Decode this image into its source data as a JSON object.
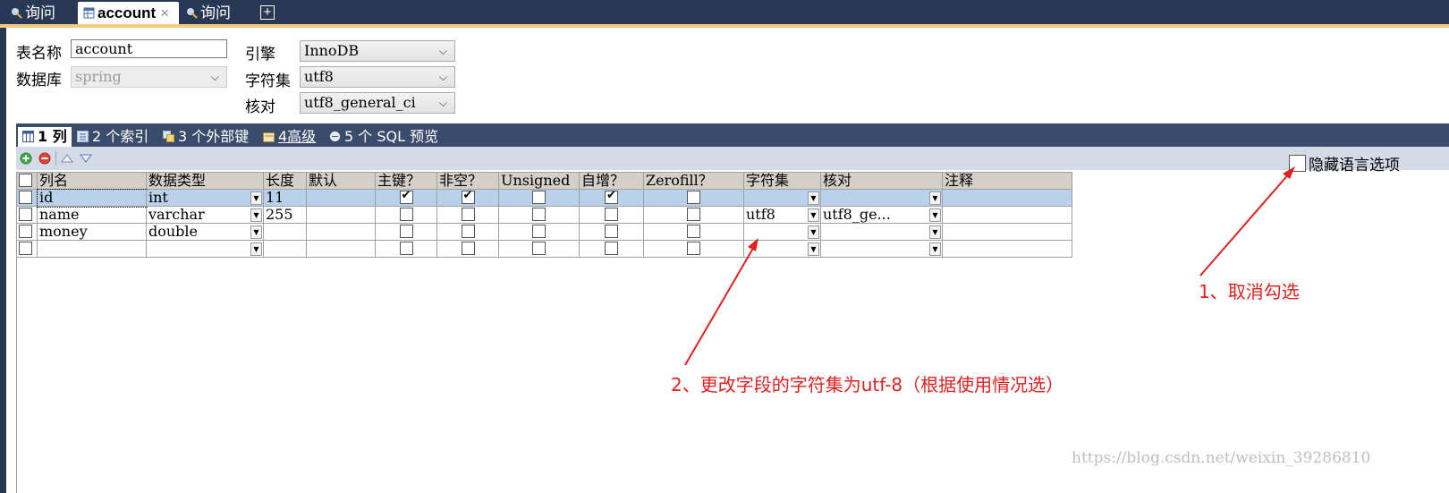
{
  "tabs": [
    {
      "label": "询问",
      "icon": "query-icon",
      "active": false
    },
    {
      "label": "account",
      "icon": "table-icon",
      "active": true,
      "close": "×"
    },
    {
      "label": "询问",
      "icon": "query-icon",
      "active": false
    }
  ],
  "add_tab": "+",
  "form": {
    "table_name_label": "表名称",
    "table_name_value": "account",
    "database_label": "数据库",
    "database_value": "spring",
    "engine_label": "引擎",
    "engine_value": "InnoDB",
    "charset_label": "字符集",
    "charset_value": "utf8",
    "collation_label": "核对",
    "collation_value": "utf8_general_ci"
  },
  "sub_tabs": [
    {
      "label": "1 列",
      "icon": "columns-icon",
      "active": true
    },
    {
      "label": "2 个索引",
      "icon": "index-icon"
    },
    {
      "label": "3 个外部键",
      "icon": "foreign-key-icon"
    },
    {
      "label": "4高级",
      "icon": "advanced-icon"
    },
    {
      "label": "5 个 SQL 预览",
      "icon": "sql-preview-icon"
    }
  ],
  "toolbar": {
    "hide_language_options": "隐藏语言选项",
    "hide_language_checked": false
  },
  "grid": {
    "headers": [
      "列名",
      "数据类型",
      "长度",
      "默认",
      "主键？",
      "非空？",
      "Unsigned",
      "自增？",
      "Zerofill？",
      "字符集",
      "核对",
      "注释"
    ],
    "rows": [
      {
        "name": "id",
        "type": "int",
        "length": "11",
        "default": "",
        "pk": true,
        "notnull": true,
        "unsigned": false,
        "autoinc": true,
        "zerofill": false,
        "charset": "",
        "collation": "",
        "comment": ""
      },
      {
        "name": "name",
        "type": "varchar",
        "length": "255",
        "default": "",
        "pk": false,
        "notnull": false,
        "unsigned": false,
        "autoinc": false,
        "zerofill": false,
        "charset": "utf8",
        "collation": "utf8_ge...",
        "comment": ""
      },
      {
        "name": "money",
        "type": "double",
        "length": "",
        "default": "",
        "pk": false,
        "notnull": false,
        "unsigned": false,
        "autoinc": false,
        "zerofill": false,
        "charset": "",
        "collation": "",
        "comment": ""
      },
      {
        "name": "",
        "type": "",
        "length": "",
        "default": "",
        "pk": false,
        "notnull": false,
        "unsigned": false,
        "autoinc": false,
        "zerofill": false,
        "charset": "",
        "collation": "",
        "comment": ""
      }
    ]
  },
  "annotations": {
    "step1": "1、取消勾选",
    "step2": "2、更改字段的字符集为utf-8（根据使用情况选）",
    "color": "#e02020"
  },
  "watermark": "https://blog.csdn.net/weixin_39286810"
}
